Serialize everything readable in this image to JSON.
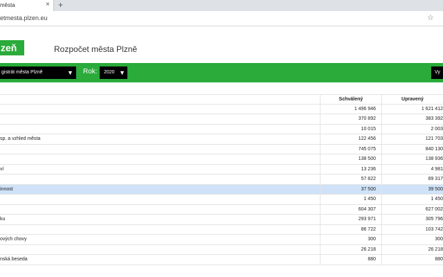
{
  "browser": {
    "tab_title": "města",
    "tab_close": "×",
    "new_tab": "+",
    "url": "etmesta.plzen.eu",
    "star": "☆"
  },
  "header": {
    "logo": "zeň",
    "title": "Rozpočet města Plzně"
  },
  "filters": {
    "organization": "gistrát města Plzně",
    "year_label": "Rok:",
    "year": "2020",
    "caret": "▼",
    "button": "Vy"
  },
  "colors": {
    "accent": "#2aab3a",
    "selected_row": "#cfe2f8"
  },
  "table": {
    "headers": {
      "name": "",
      "approved": "Schválený",
      "adjusted": "Upravený"
    },
    "rows": [
      {
        "name": "",
        "approved": "1 496 946",
        "adjusted": "1 621 412"
      },
      {
        "name": "",
        "approved": "370 892",
        "adjusted": "383 392"
      },
      {
        "name": "",
        "approved": "10 015",
        "adjusted": "2 003"
      },
      {
        "name": "sp. a vzhled města",
        "approved": "122 456",
        "adjusted": "121 703"
      },
      {
        "name": "",
        "approved": "745 075",
        "adjusted": "840 130"
      },
      {
        "name": "",
        "approved": "138 500",
        "adjusted": "138 936"
      },
      {
        "name": "ví",
        "approved": "13 236",
        "adjusted": "4 981"
      },
      {
        "name": "",
        "approved": "57 822",
        "adjusted": "89 317"
      },
      {
        "name": "innost",
        "approved": "37 500",
        "adjusted": "39 500",
        "selected": true
      },
      {
        "name": "",
        "approved": "1 450",
        "adjusted": "1 450"
      },
      {
        "name": "",
        "approved": "604 307",
        "adjusted": "627 002"
      },
      {
        "name": "ku",
        "approved": "293 971",
        "adjusted": "305 796"
      },
      {
        "name": "",
        "approved": "86 722",
        "adjusted": "103 742"
      },
      {
        "name": "ových chovy",
        "approved": "300",
        "adjusted": "300"
      },
      {
        "name": "",
        "approved": "26 218",
        "adjusted": "26 218"
      },
      {
        "name": "nská beseda",
        "approved": "880",
        "adjusted": "880"
      }
    ]
  }
}
